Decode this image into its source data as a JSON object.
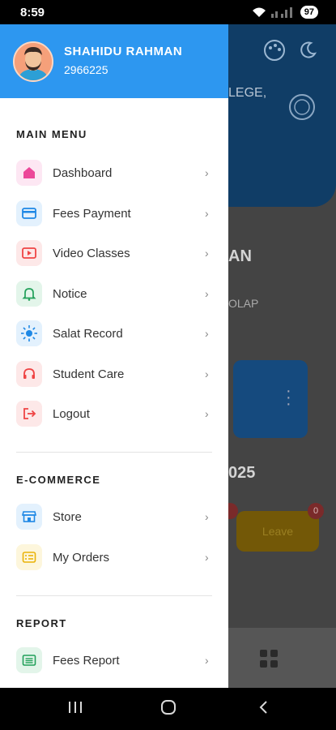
{
  "status_bar": {
    "time": "8:59",
    "battery": "97"
  },
  "user": {
    "name": "SHAHIDU RAHMAN",
    "id": "2966225"
  },
  "sections": {
    "main_menu": "MAIN MENU",
    "ecommerce": "E-COMMERCE",
    "report": "REPORT"
  },
  "menu": {
    "dashboard": "Dashboard",
    "fees_payment": "Fees Payment",
    "video_classes": "Video Classes",
    "notice": "Notice",
    "salat_record": "Salat Record",
    "student_care": "Student Care",
    "logout": "Logout",
    "store": "Store",
    "my_orders": "My Orders",
    "fees_report": "Fees Report"
  },
  "background": {
    "college_text": "LEGE,",
    "name_text": "AN",
    "place_text": "OLAP",
    "year_text": "025",
    "leave_button": "Leave",
    "leave_badge": "0"
  },
  "colors": {
    "header_blue": "#2d97f0",
    "icon_pink": "#ec4899",
    "icon_blue": "#1e88e5",
    "icon_red": "#ef4444",
    "icon_green": "#22a05a",
    "icon_yellow": "#eab308"
  }
}
